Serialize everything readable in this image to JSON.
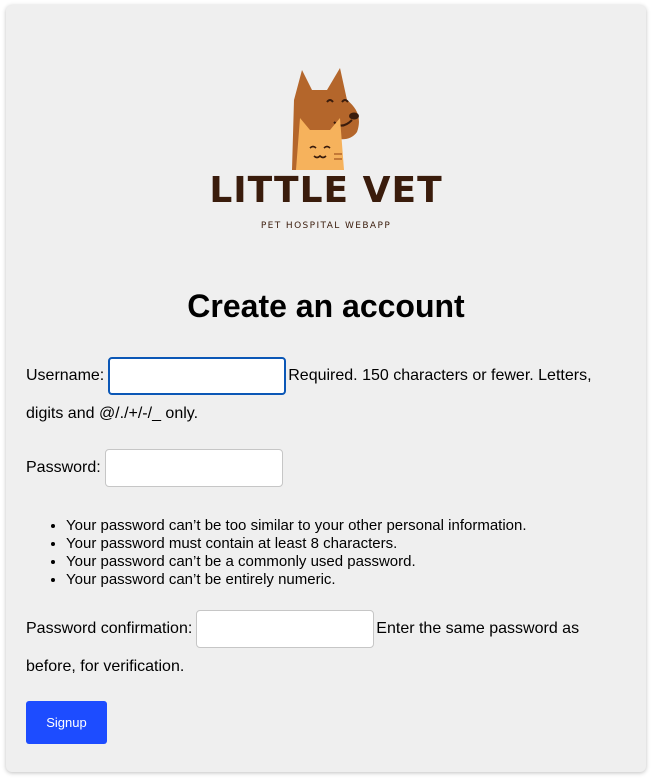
{
  "brand": {
    "name": "LITTLE VET",
    "tagline": "PET HOSPITAL WEBAPP"
  },
  "form": {
    "title": "Create an account",
    "username": {
      "label": "Username:",
      "value": "",
      "help": "Required. 150 characters or fewer. Letters, digits and @/./+/-/_ only."
    },
    "password": {
      "label": "Password:",
      "value": "",
      "rules": [
        "Your password can’t be too similar to your other personal information.",
        "Your password must contain at least 8 characters.",
        "Your password can’t be a commonly used password.",
        "Your password can’t be entirely numeric."
      ]
    },
    "password_confirmation": {
      "label": "Password confirmation:",
      "value": "",
      "help": "Enter the same password as before, for verification."
    },
    "submit_label": "Signup"
  },
  "colors": {
    "card_background": "#efefef",
    "button": "#1d4cff",
    "brand_text": "#3a1c0c",
    "dog": "#b4662b",
    "cat": "#f6b25c",
    "focus_border": "#0b57b6"
  }
}
